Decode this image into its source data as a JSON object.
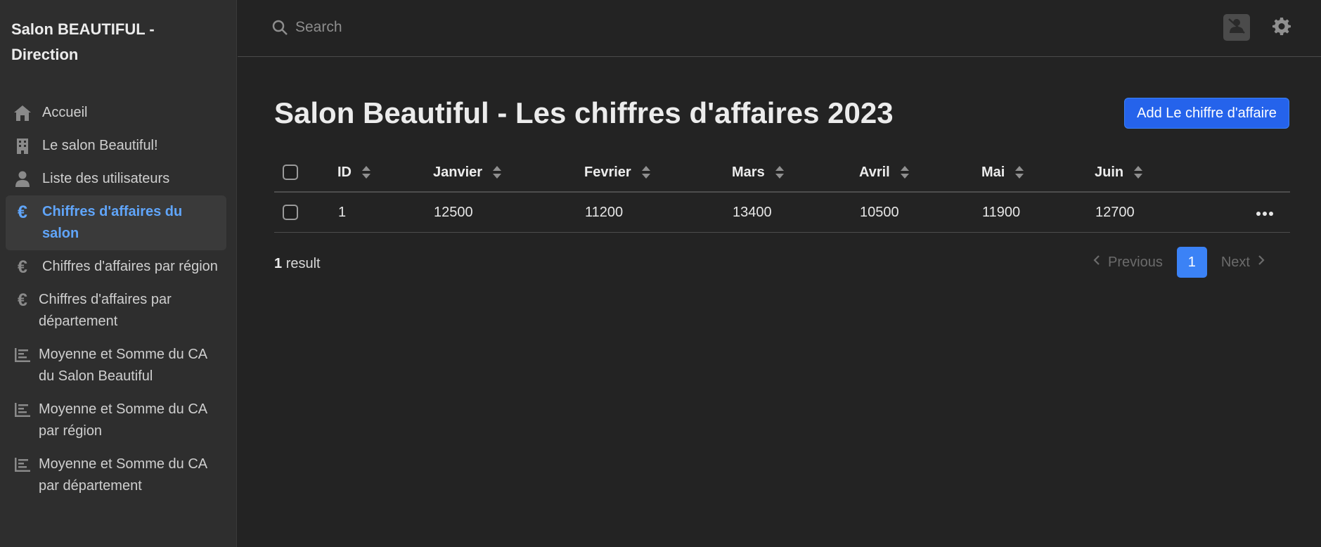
{
  "sidebar": {
    "brand": "Salon BEAUTIFUL - Direction",
    "items": [
      {
        "label": "Accueil",
        "icon": "home-icon"
      },
      {
        "label": "Le salon Beautiful!",
        "icon": "building-icon"
      },
      {
        "label": "Liste des utilisateurs",
        "icon": "user-icon"
      },
      {
        "label": "Chiffres d'affaires du salon",
        "icon": "euro-icon",
        "active": true
      },
      {
        "label": "Chiffres d'affaires par région",
        "icon": "euro-icon"
      },
      {
        "label": "Chiffres d'affaires par département",
        "icon": "euro-icon"
      },
      {
        "label": "Moyenne et Somme du CA du Salon Beautiful",
        "icon": "chart-icon"
      },
      {
        "label": "Moyenne et Somme du CA par région",
        "icon": "chart-icon"
      },
      {
        "label": "Moyenne et Somme du CA par département",
        "icon": "chart-icon"
      }
    ]
  },
  "header": {
    "search_placeholder": "Search",
    "user_icon": "user-slash-icon",
    "settings_icon": "gear-icon"
  },
  "main": {
    "title": "Salon Beautiful - Les chiffres d'affaires 2023",
    "add_button": "Add Le chiffre d'affaire",
    "table": {
      "columns": [
        "ID",
        "Janvier",
        "Fevrier",
        "Mars",
        "Avril",
        "Mai",
        "Juin"
      ],
      "rows": [
        {
          "id": "1",
          "janvier": "12500",
          "fevrier": "11200",
          "mars": "13400",
          "avril": "10500",
          "mai": "11900",
          "juin": "12700"
        }
      ]
    },
    "result_count": "1",
    "result_label": "result",
    "pagination": {
      "previous": "Previous",
      "current_page": "1",
      "next": "Next"
    }
  },
  "colors": {
    "accent": "#2563eb",
    "active_link": "#60a5fa",
    "background": "#232323",
    "sidebar": "#2e2e2e"
  }
}
